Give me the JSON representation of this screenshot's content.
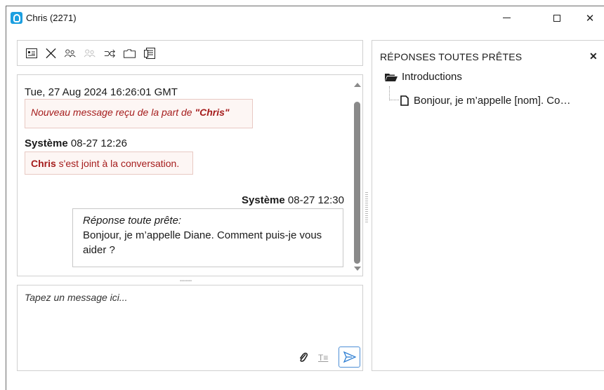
{
  "window": {
    "title": "Chris (2271)",
    "min_label": "",
    "close_glyph": "✕"
  },
  "toolbar": {
    "icons": [
      "contact-card-icon",
      "end-chat-icon",
      "transfer-agent-icon",
      "conference-icon",
      "transfer-queue-icon",
      "folder-icon",
      "transcript-icon"
    ]
  },
  "conversation": {
    "timestamp": "Tue, 27 Aug 2024 16:26:01 GMT",
    "notice_prefix": "Nouveau message reçu de la part de ",
    "notice_sender": "\"Chris\"",
    "system_msg1": {
      "author": "Système",
      "time": "08-27 12:26",
      "name": "Chris",
      "text": " s'est joint à la conversation."
    },
    "system_msg2": {
      "author": "Système",
      "time": "08-27 12:30",
      "label": "Réponse toute prête:",
      "text": "Bonjour, je m’appelle Diane. Comment puis-je vous aider ?"
    }
  },
  "composer": {
    "placeholder": "Tapez un message ici..."
  },
  "responses": {
    "title": "RÉPONSES TOUTES PRÊTES",
    "close_glyph": "✕",
    "folder": "Introductions",
    "item": "Bonjour, je m’appelle [nom]. Co…"
  },
  "colors": {
    "accent": "#1c9fe0",
    "notice_text": "#a51c1c",
    "notice_bg": "#fdf6f4",
    "send_border": "#4d8fd6"
  }
}
